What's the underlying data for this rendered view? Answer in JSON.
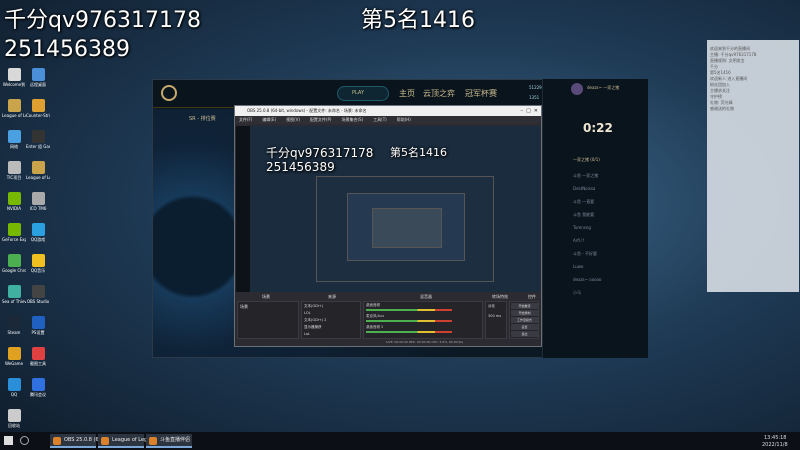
{
  "overlay": {
    "line1": "千分qv976317178",
    "line2": "251456389",
    "rank": "第5名1416"
  },
  "desktop_icons": [
    {
      "label": "Welcome到",
      "color": "#d9d9d9"
    },
    {
      "label": "远程桌面",
      "color": "#4a8fd8"
    },
    {
      "label": "League of Legends",
      "color": "#c9a44a"
    },
    {
      "label": "Counter-Strike Global Off..",
      "color": "#e0a030"
    },
    {
      "label": "网络",
      "color": "#4aa0e0"
    },
    {
      "label": "Enter 组 Gaming",
      "color": "#333"
    },
    {
      "label": "TIC项目",
      "color": "#bbb"
    },
    {
      "label": "League of Legends",
      "color": "#c9a44a"
    },
    {
      "label": "NVIDIA",
      "color": "#76b900"
    },
    {
      "label": "ICO TM6",
      "color": "#aaa"
    },
    {
      "label": "GeForce Experience",
      "color": "#76b900"
    },
    {
      "label": "QQ游戏",
      "color": "#2aa0e0"
    },
    {
      "label": "Google Chrome",
      "color": "#4caf50"
    },
    {
      "label": "QQ音乐",
      "color": "#f0c020"
    },
    {
      "label": "Sea of Thieves",
      "color": "#40b0a0"
    },
    {
      "label": "OBS Studio",
      "color": "#444"
    },
    {
      "label": "Steam",
      "color": "#1b2838"
    },
    {
      "label": "PS设置",
      "color": "#2060c0"
    },
    {
      "label": "WeGame",
      "color": "#e0a020"
    },
    {
      "label": "截图工具",
      "color": "#e04040"
    },
    {
      "label": "QQ",
      "color": "#2a8fd8"
    },
    {
      "label": "腾讯会议",
      "color": "#3070e0"
    },
    {
      "label": "回收站",
      "color": "#ccc"
    }
  ],
  "lol_client": {
    "play_button": "PLAY",
    "nav": [
      "主页",
      "云顶之弈",
      "冠军杯赛"
    ],
    "icons": [
      "主页",
      "藏品",
      "商店",
      "游戏"
    ],
    "currency_be": "51229",
    "currency_rp": "1351",
    "username": "deazs~ 一家之猪",
    "lobby_text": "SR - 排位赛",
    "timer": "0:22",
    "friends_group": "一家之猪 (0/1)",
    "friends": [
      "斗鱼 一家之猪",
      "DestNoissa",
      "斗鱼 一直要",
      "斗鱼 我能要",
      "Tumnsng",
      "Arfl.!!",
      "斗鱼 - 不好要",
      "Luwo",
      "deazs~ ooooo",
      "小马"
    ]
  },
  "obs": {
    "title": "OBS 25.0.8 (64-bit, windows) - 配置文件: 未命名 - 场景: 未命名",
    "menu": [
      "文件(F)",
      "编辑(E)",
      "视图(V)",
      "配置文件(P)",
      "场景集合(S)",
      "工具(T)",
      "帮助(H)"
    ],
    "dock_heads": [
      "场景",
      "来源",
      "混音器",
      "转场特效",
      "控件"
    ],
    "scene": "场景",
    "sources": [
      "文本(GDI+)",
      "LOL",
      "文本(GDI+) 2",
      "显示器捕获",
      "LoL"
    ],
    "mixer": [
      "桌面音频",
      "麦克风/Aux",
      "桌面音频 2"
    ],
    "transition": "淡化",
    "duration": "300 ms",
    "controls": [
      "开始推流",
      "开始录制",
      "工作室模式",
      "设置",
      "退出"
    ],
    "status": "LIVE: 00:00:00  REC: 00:00:00  CPU: 3.6%, 60.00 fps"
  },
  "chat": {
    "lines": [
      "欢迎来到千分的直播间",
      "主播: 千分qv976317178",
      "直播规则: 文明发言",
      "千分",
      "第5名1416",
      "欢迎新人 进入直播间",
      "粉丝团加入",
      "主播求关注",
      "守护榜",
      "礼物: 荧光棒",
      "感谢送的礼物"
    ]
  },
  "taskbar": {
    "apps": [
      "OBS 25.0.8 (64-bit, w...",
      "League of Legends",
      "斗鱼直播伴侣"
    ],
    "time": "13:45:18",
    "date": "2022/11/8"
  }
}
